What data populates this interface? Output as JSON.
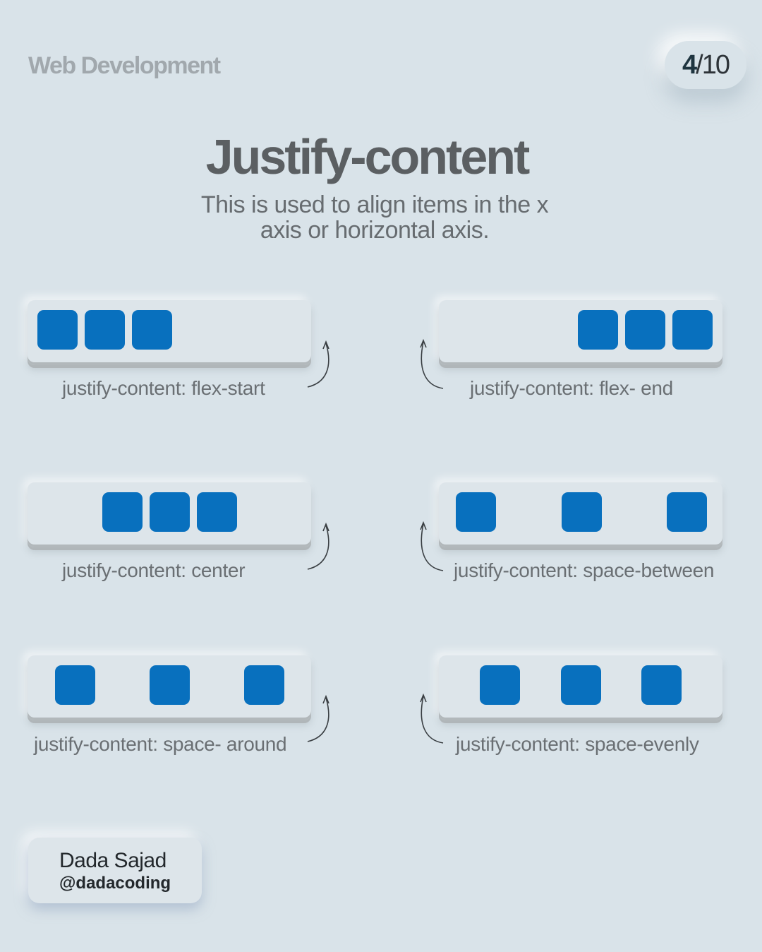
{
  "header": {
    "brand": "Web Development",
    "page_current": "4",
    "page_total": "/10"
  },
  "title": "Justify-content",
  "subtitle": {
    "line1": "This is used to align items in the x",
    "line2": "axis or horizontal axis."
  },
  "examples": [
    {
      "label": "justify-content: flex-start",
      "justify": "flex-start",
      "box_count": 3
    },
    {
      "label": "justify-content: flex- end",
      "justify": "flex-end",
      "box_count": 3
    },
    {
      "label": "justify-content: center",
      "justify": "center",
      "box_count": 3
    },
    {
      "label": "justify-content: space-between",
      "justify": "space-between",
      "box_count": 3
    },
    {
      "label": "justify-content: space- around",
      "justify": "space-around",
      "box_count": 3
    },
    {
      "label": "justify-content: space-evenly",
      "justify": "space-evenly",
      "box_count": 3
    }
  ],
  "author": {
    "name": "Dada Sajad",
    "handle": "@dadacoding"
  },
  "colors": {
    "background": "#d9e3e9",
    "box": "#0870be",
    "panel": "#dde5ea"
  },
  "icons": [
    "curved-arrow-icon"
  ]
}
